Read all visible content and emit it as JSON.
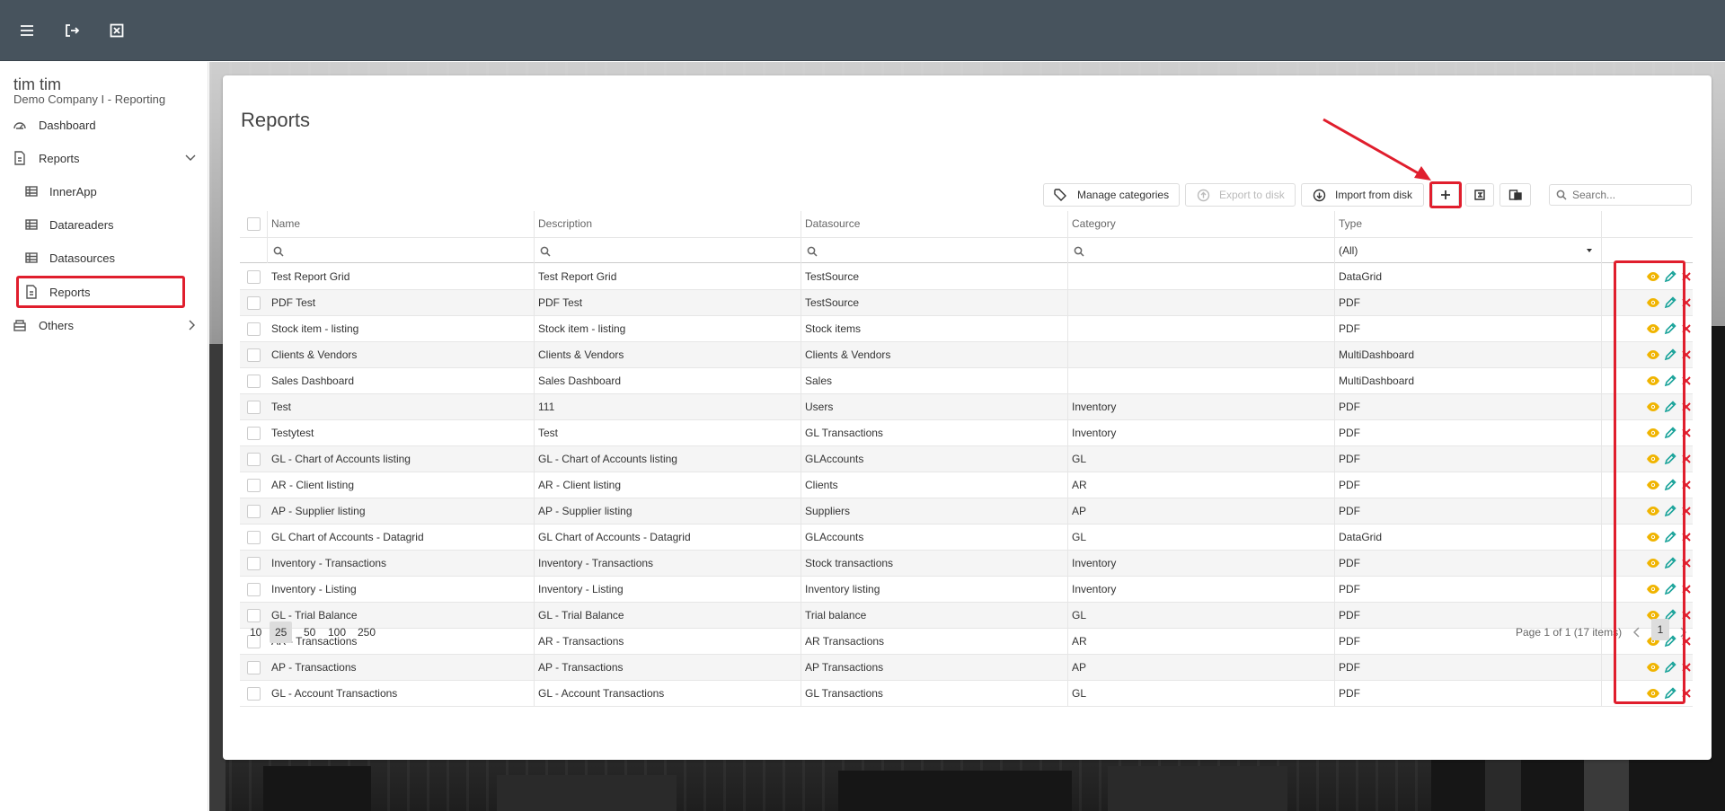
{
  "user": {
    "name": "tim tim",
    "company": "Demo Company I - Reporting"
  },
  "sidebar": {
    "items": [
      {
        "label": "Dashboard",
        "icon": "dashboard-gauge-icon"
      },
      {
        "label": "Reports",
        "icon": "report-file-icon",
        "expanded": true
      },
      {
        "label": "InnerApp",
        "icon": "grid-table-icon"
      },
      {
        "label": "Datareaders",
        "icon": "grid-table-icon"
      },
      {
        "label": "Datasources",
        "icon": "grid-table-icon"
      },
      {
        "label": "Reports",
        "icon": "report-file-icon",
        "selected": true
      },
      {
        "label": "Others",
        "icon": "box-icon"
      }
    ]
  },
  "page": {
    "title": "Reports"
  },
  "toolbar": {
    "manage_categories": "Manage categories",
    "export_to_disk": "Export to disk",
    "import_from_disk": "Import from disk",
    "add_icon": "plus-icon",
    "column_chooser_icon": "column-chooser-icon",
    "export_icon": "export-grid-icon",
    "search_placeholder": "Search..."
  },
  "grid": {
    "columns": [
      "Name",
      "Description",
      "Datasource",
      "Category",
      "Type"
    ],
    "type_filter": "(All)",
    "rows": [
      [
        "Test Report Grid",
        "Test Report Grid",
        "TestSource",
        "",
        "DataGrid"
      ],
      [
        "PDF Test",
        "PDF Test",
        "TestSource",
        "",
        "PDF"
      ],
      [
        "Stock item - listing",
        "Stock item - listing",
        "Stock items",
        "",
        "PDF"
      ],
      [
        "Clients & Vendors",
        "Clients & Vendors",
        "Clients & Vendors",
        "",
        "MultiDashboard"
      ],
      [
        "Sales Dashboard",
        "Sales Dashboard",
        "Sales",
        "",
        "MultiDashboard"
      ],
      [
        "Test",
        "111",
        "Users",
        "Inventory",
        "PDF"
      ],
      [
        "Testytest",
        "Test",
        "GL Transactions",
        "Inventory",
        "PDF"
      ],
      [
        "GL - Chart of Accounts listing",
        "GL - Chart of Accounts listing",
        "GLAccounts",
        "GL",
        "PDF"
      ],
      [
        "AR - Client listing",
        "AR - Client listing",
        "Clients",
        "AR",
        "PDF"
      ],
      [
        "AP - Supplier listing",
        "AP - Supplier listing",
        "Suppliers",
        "AP",
        "PDF"
      ],
      [
        "GL Chart of Accounts - Datagrid",
        "GL Chart of Accounts - Datagrid",
        "GLAccounts",
        "GL",
        "DataGrid"
      ],
      [
        "Inventory - Transactions",
        "Inventory - Transactions",
        "Stock transactions",
        "Inventory",
        "PDF"
      ],
      [
        "Inventory - Listing",
        "Inventory - Listing",
        "Inventory listing",
        "Inventory",
        "PDF"
      ],
      [
        "GL - Trial Balance",
        "GL - Trial Balance",
        "Trial balance",
        "GL",
        "PDF"
      ],
      [
        "AR - Transactions",
        "AR - Transactions",
        "AR Transactions",
        "AR",
        "PDF"
      ],
      [
        "AP - Transactions",
        "AP - Transactions",
        "AP Transactions",
        "AP",
        "PDF"
      ],
      [
        "GL - Account Transactions",
        "GL - Account Transactions",
        "GL Transactions",
        "GL",
        "PDF"
      ]
    ],
    "row_actions": [
      "view-eye-icon",
      "edit-pencil-icon",
      "delete-x-icon"
    ]
  },
  "pager": {
    "sizes": [
      "10",
      "25",
      "50",
      "100",
      "250"
    ],
    "selected_size": "25",
    "info": "Page 1 of 1 (17 items)",
    "current_page": "1"
  },
  "colors": {
    "topbar": "#47535d",
    "annotation": "#e01e2d",
    "eye": "#f0b400",
    "pencil": "#1aa39a",
    "delete": "#e01e2d"
  }
}
